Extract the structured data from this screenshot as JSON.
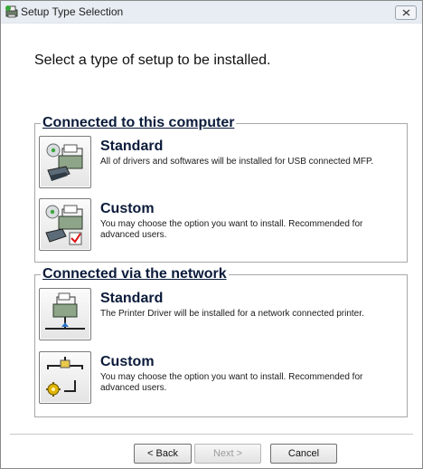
{
  "window": {
    "title": "Setup Type Selection",
    "close_icon": "close-icon"
  },
  "heading": "Select a type of setup to be installed.",
  "groups": [
    {
      "label": "Connected to this computer",
      "options": [
        {
          "title": "Standard",
          "description": "All of drivers and softwares will be installed for USB connected MFP.",
          "icon": "usb-standard-setup-icon"
        },
        {
          "title": "Custom",
          "description": "You may choose the option you want to install. Recommended for advanced users.",
          "icon": "usb-custom-setup-icon"
        }
      ]
    },
    {
      "label": "Connected via the network",
      "options": [
        {
          "title": "Standard",
          "description": "The Printer Driver will be installed for a network connected printer.",
          "icon": "network-standard-setup-icon"
        },
        {
          "title": "Custom",
          "description": "You may choose the option you want to install. Recommended for advanced users.",
          "icon": "network-custom-setup-icon"
        }
      ]
    }
  ],
  "buttons": {
    "back": "< Back",
    "next": "Next >",
    "cancel": "Cancel"
  }
}
